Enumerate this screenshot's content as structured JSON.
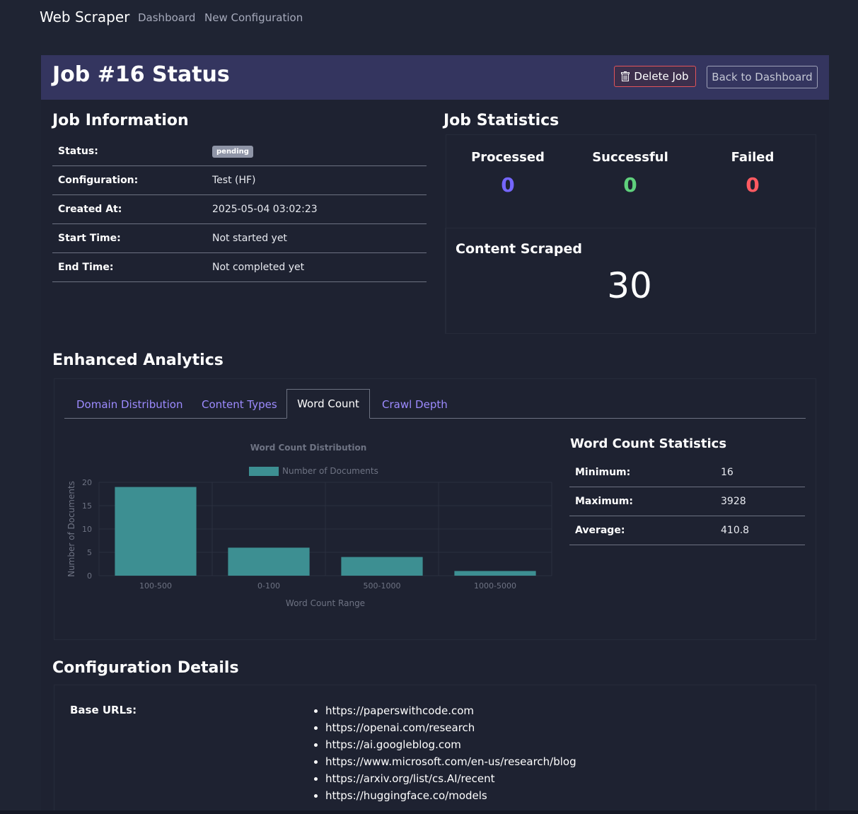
{
  "nav": {
    "brand": "Web Scraper",
    "links": [
      "Dashboard",
      "New Configuration"
    ]
  },
  "header": {
    "title": "Job #16 Status",
    "delete_label": "Delete Job",
    "back_label": "Back to Dashboard"
  },
  "job_info": {
    "heading": "Job Information",
    "rows": [
      {
        "label": "Status:",
        "value": "pending"
      },
      {
        "label": "Configuration:",
        "value": "Test (HF)"
      },
      {
        "label": "Created At:",
        "value": "2025-05-04 03:02:23"
      },
      {
        "label": "Start Time:",
        "value": "Not started yet"
      },
      {
        "label": "End Time:",
        "value": "Not completed yet"
      }
    ]
  },
  "job_stats": {
    "heading": "Job Statistics",
    "processed_label": "Processed",
    "processed_value": "0",
    "successful_label": "Successful",
    "successful_value": "0",
    "failed_label": "Failed",
    "failed_value": "0",
    "content_label": "Content Scraped",
    "content_value": "30"
  },
  "analytics": {
    "heading": "Enhanced Analytics",
    "tabs": [
      "Domain Distribution",
      "Content Types",
      "Word Count",
      "Crawl Depth"
    ],
    "active_tab": "Word Count",
    "stats_heading": "Word Count Statistics",
    "stats_rows": [
      {
        "label": "Minimum:",
        "value": "16"
      },
      {
        "label": "Maximum:",
        "value": "3928"
      },
      {
        "label": "Average:",
        "value": "410.8"
      }
    ]
  },
  "chart_data": {
    "type": "bar",
    "title": "Word Count Distribution",
    "xlabel": "Word Count Range",
    "ylabel": "Number of Documents",
    "categories": [
      "100-500",
      "0-100",
      "500-1000",
      "1000-5000"
    ],
    "series": [
      {
        "name": "Number of Documents",
        "values": [
          19,
          6,
          4,
          1
        ]
      }
    ],
    "ylim": [
      0,
      20
    ],
    "yticks": [
      "0",
      "5",
      "10",
      "15",
      "20"
    ],
    "legend": "top",
    "grid": true,
    "bar_color": "#3d8f92"
  },
  "config": {
    "heading": "Configuration Details",
    "base_urls_label": "Base URLs:",
    "base_urls": [
      "https://paperswithcode.com",
      "https://openai.com/research",
      "https://ai.googleblog.com",
      "https://www.microsoft.com/en-us/research/blog",
      "https://arxiv.org/list/cs.AI/recent",
      "https://huggingface.co/models"
    ]
  },
  "colors": {
    "processed": "#7566ff",
    "successful": "#5fd07c",
    "failed": "#ff5a61"
  }
}
